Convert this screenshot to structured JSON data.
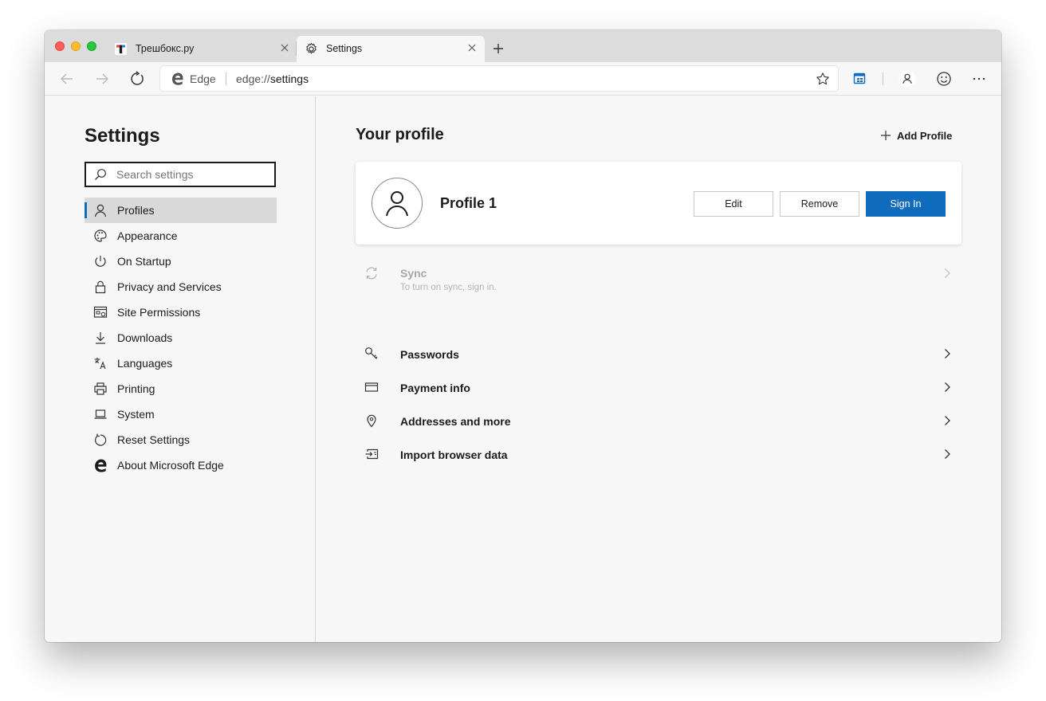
{
  "tabs": [
    {
      "title": "Трешбокс.ру",
      "icon": "trashbox-favicon"
    },
    {
      "title": "Settings",
      "icon": "settings-gear-icon",
      "active": true
    }
  ],
  "address_bar": {
    "site_name": "Edge",
    "url_prefix": "edge://",
    "url_path": "settings"
  },
  "sidebar": {
    "title": "Settings",
    "search_placeholder": "Search settings",
    "items": [
      {
        "label": "Profiles",
        "icon": "person-icon",
        "active": true
      },
      {
        "label": "Appearance",
        "icon": "palette-icon"
      },
      {
        "label": "On Startup",
        "icon": "power-icon"
      },
      {
        "label": "Privacy and Services",
        "icon": "lock-icon"
      },
      {
        "label": "Site Permissions",
        "icon": "site-permissions-icon"
      },
      {
        "label": "Downloads",
        "icon": "download-icon"
      },
      {
        "label": "Languages",
        "icon": "languages-icon"
      },
      {
        "label": "Printing",
        "icon": "printer-icon"
      },
      {
        "label": "System",
        "icon": "laptop-icon"
      },
      {
        "label": "Reset Settings",
        "icon": "reset-icon"
      },
      {
        "label": "About Microsoft Edge",
        "icon": "edge-logo-icon"
      }
    ]
  },
  "main": {
    "title": "Your profile",
    "add_profile_label": "Add Profile",
    "profile": {
      "name": "Profile 1",
      "edit_label": "Edit",
      "remove_label": "Remove",
      "sign_in_label": "Sign In"
    },
    "sync": {
      "label": "Sync",
      "sublabel": "To turn on sync, sign in."
    },
    "rows": [
      {
        "label": "Passwords",
        "icon": "key-icon"
      },
      {
        "label": "Payment info",
        "icon": "card-icon"
      },
      {
        "label": "Addresses and more",
        "icon": "location-pin-icon"
      },
      {
        "label": "Import browser data",
        "icon": "import-icon"
      }
    ]
  },
  "colors": {
    "accent": "#0f6cbd",
    "window_bg": "#f7f7f7",
    "tabstrip_bg": "#dcdcdc"
  }
}
